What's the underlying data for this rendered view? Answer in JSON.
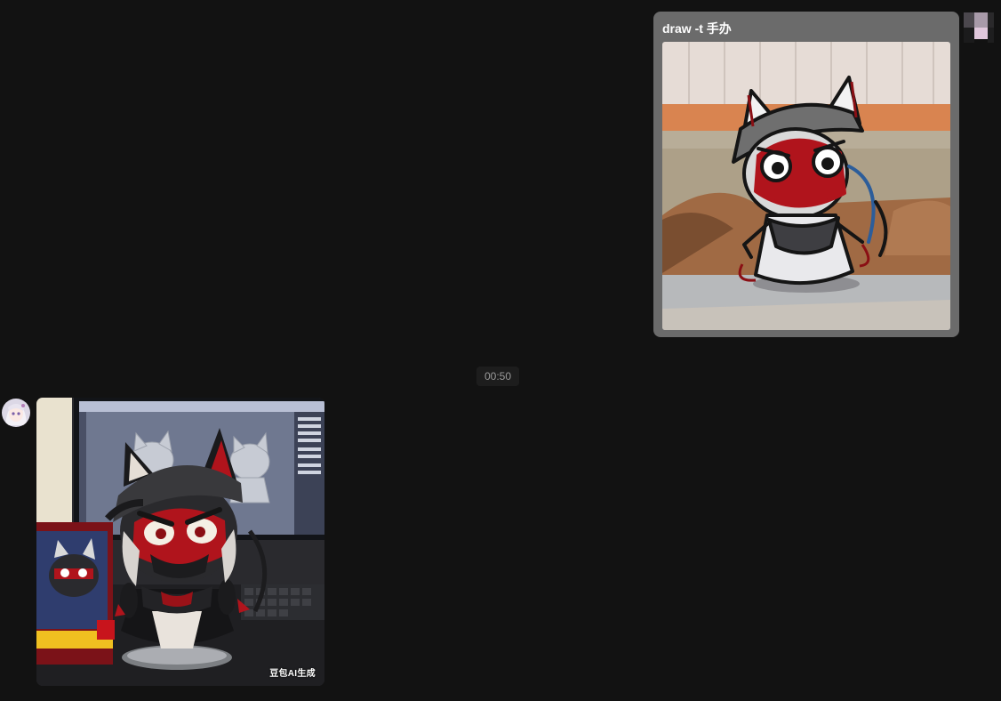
{
  "conversation": {
    "outgoing_message": {
      "text": "draw -t 手办",
      "image_description_icon": "sketch-cat-ninja-image"
    },
    "time_divider": "00:50",
    "incoming_message": {
      "image_icon": "figure-render-image",
      "watermark": "豆包AI生成"
    }
  },
  "colors": {
    "background": "#121212",
    "bubble_out": "#6b6b6b",
    "time_pill": "#1d1d1d",
    "time_text": "#9a9a9a",
    "accent_red": "#b0141c"
  }
}
